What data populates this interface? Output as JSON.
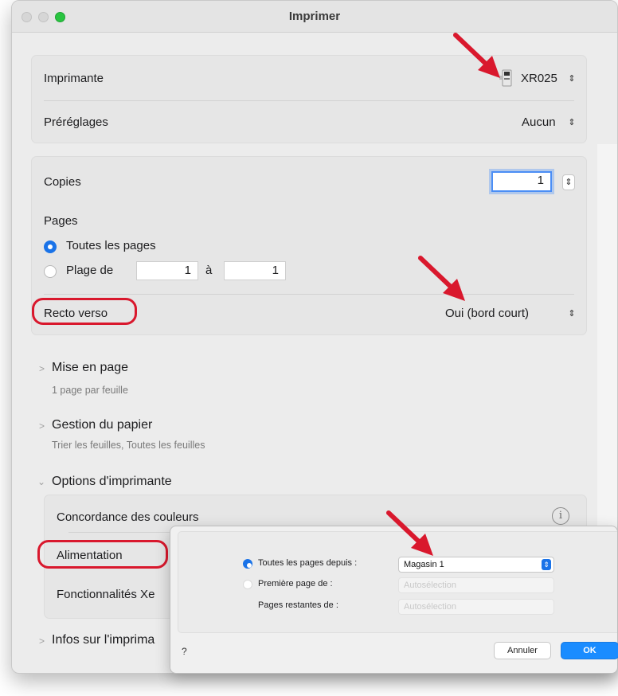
{
  "window": {
    "title": "Imprimer"
  },
  "printer": {
    "label": "Imprimante",
    "value": "XR025"
  },
  "presets": {
    "label": "Préréglages",
    "value": "Aucun"
  },
  "copies": {
    "label": "Copies",
    "value": "1"
  },
  "pages": {
    "label": "Pages",
    "all_label": "Toutes les pages",
    "range_label": "Plage de",
    "from": "1",
    "to_label": "à",
    "to": "1"
  },
  "duplex": {
    "label": "Recto verso",
    "value": "Oui (bord court)"
  },
  "sections": {
    "layout": {
      "title": "Mise en page",
      "summary": "1 page par feuille"
    },
    "paper": {
      "title": "Gestion du papier",
      "summary": "Trier les feuilles, Toutes les feuilles"
    },
    "printer_options": {
      "title": "Options d'imprimante",
      "items": [
        "Concordance des couleurs",
        "Alimentation",
        "Fonctionnalités Xe"
      ]
    },
    "info": {
      "title": "Infos sur l'imprima"
    }
  },
  "feed_dialog": {
    "all_pages_label": "Toutes les pages depuis :",
    "all_pages_value": "Magasin 1",
    "first_page_label": "Première page de :",
    "first_page_value": "Autosélection",
    "remaining_label": "Pages restantes de :",
    "remaining_value": "Autosélection",
    "help": "?",
    "cancel": "Annuler",
    "ok": "OK"
  },
  "colors": {
    "accent": "#1a73e8",
    "annotation": "#d9182d",
    "ok_button": "#1a8cff"
  },
  "icons": [
    "printer-icon",
    "chevron-updown-icon",
    "info-icon",
    "disclosure-chevron-icon",
    "red-arrow"
  ]
}
